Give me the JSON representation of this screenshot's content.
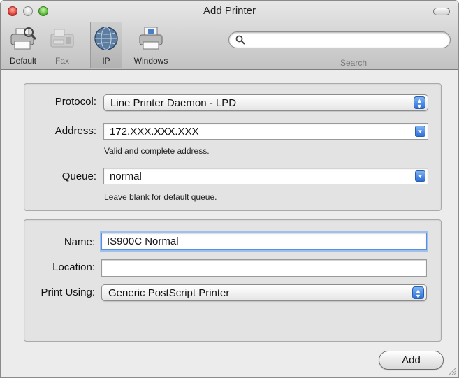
{
  "window": {
    "title": "Add Printer"
  },
  "toolbar": {
    "items": [
      {
        "label": "Default",
        "icon": "default-printer-icon"
      },
      {
        "label": "Fax",
        "icon": "fax-icon"
      },
      {
        "label": "IP",
        "icon": "globe-icon"
      },
      {
        "label": "Windows",
        "icon": "windows-printer-icon"
      }
    ],
    "selected": "IP",
    "search": {
      "label": "Search",
      "value": "",
      "icon": "magnifier-icon"
    }
  },
  "connection": {
    "protocol": {
      "label": "Protocol:",
      "value": "Line Printer Daemon - LPD"
    },
    "address": {
      "label": "Address:",
      "value": "172.XXX.XXX.XXX",
      "hint": "Valid and complete address."
    },
    "queue": {
      "label": "Queue:",
      "value": "normal",
      "hint": "Leave blank for default queue."
    }
  },
  "printer": {
    "name": {
      "label": "Name:",
      "value": "IS900C Normal"
    },
    "location": {
      "label": "Location:",
      "value": ""
    },
    "print_using": {
      "label": "Print Using:",
      "value": "Generic PostScript Printer"
    }
  },
  "actions": {
    "add_label": "Add"
  },
  "colors": {
    "accent": "#2a6fdb",
    "focus_ring": "#9cc0f0"
  }
}
